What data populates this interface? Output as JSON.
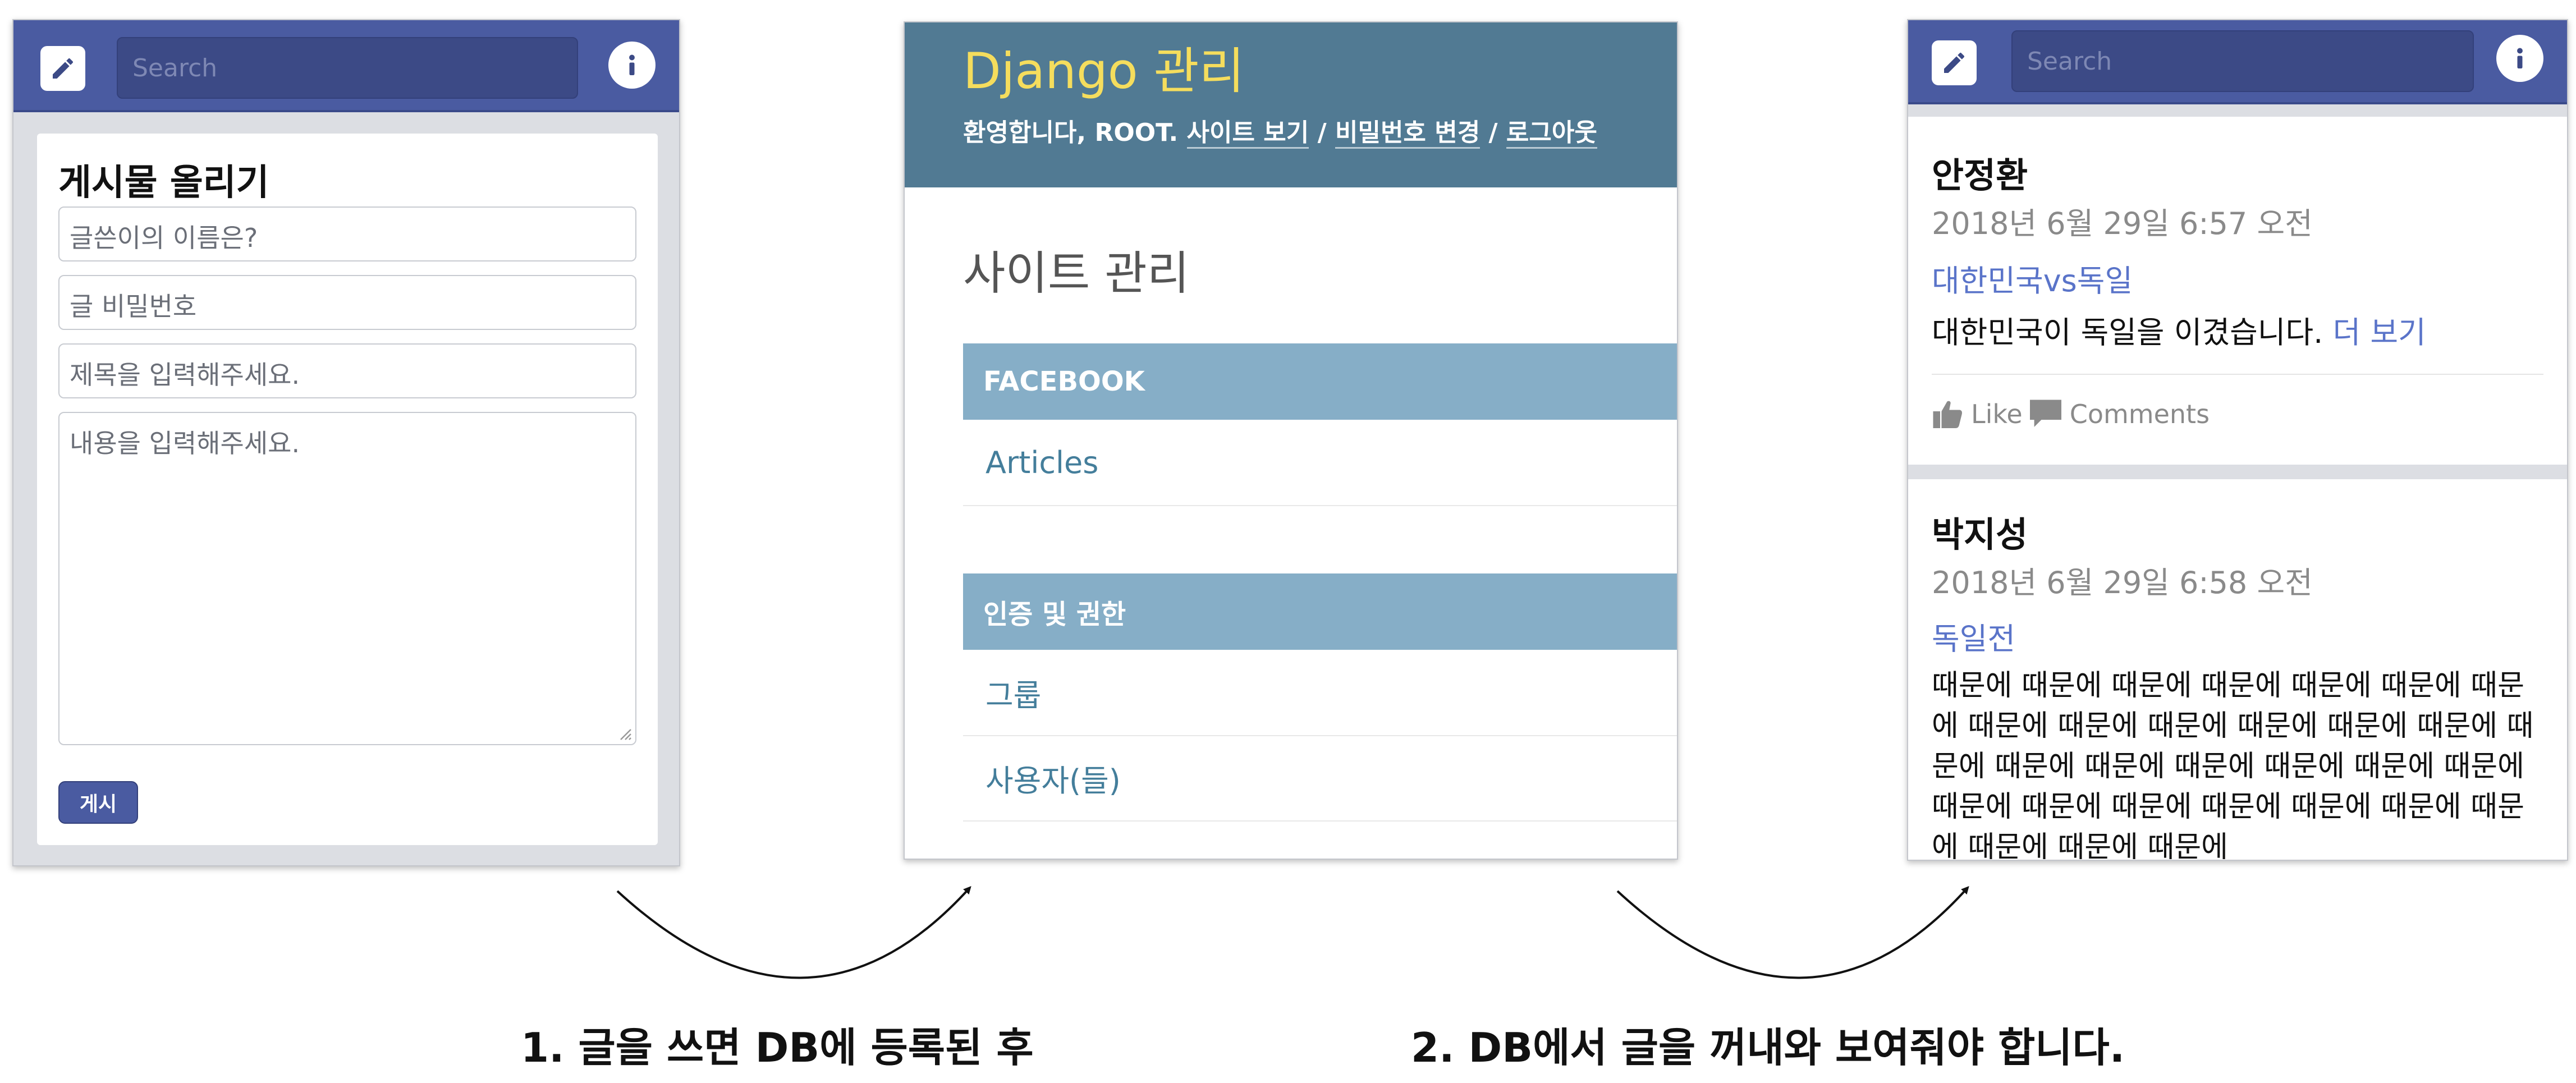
{
  "post_form": {
    "search_placeholder": "Search",
    "title": "게시물 올리기",
    "name_placeholder": "글쓴이의 이름은?",
    "password_placeholder": "글 비밀번호",
    "subject_placeholder": "제목을 입력해주세요.",
    "content_placeholder": "내용을 입력해주세요.",
    "submit_label": "게시"
  },
  "admin": {
    "brand": "Django 관리",
    "welcome": "환영합니다,",
    "user": "ROOT",
    "view_site": "사이트 보기",
    "change_password": "비밀번호 변경",
    "logout": "로그아웃",
    "site_admin_title": "사이트 관리",
    "sections": [
      {
        "caption": "FACEBOOK",
        "rows": [
          "Articles"
        ]
      },
      {
        "caption": "인증 및 권한",
        "rows": [
          "그룹",
          "사용자(들)"
        ]
      }
    ]
  },
  "feed": {
    "search_placeholder": "Search",
    "posts": [
      {
        "author": "안정환",
        "date": "2018년 6월 29일 6:57 오전",
        "title": "대한민국vs독일",
        "body": "대한민국이 독일을 이겼습니다.",
        "more": "더 보기",
        "like_label": "Like",
        "comments_label": "Comments"
      },
      {
        "author": "박지성",
        "date": "2018년 6월 29일 6:58 오전",
        "title": "독일전",
        "body": "때문에 때문에 때문에 때문에 때문에 때문에 때문에 때문에 때문에 때문에 때문에 때문에 때문에 때문에 때문에 때문에 때문에 때문에 때문에 때문에 때문에 때문에 때문에 때문에 때문에 때문에 때문에 때문에 때문에 때문에"
      }
    ]
  },
  "captions": {
    "step1": "1. 글을 쓰면 DB에 등록된 후",
    "step2": "2. DB에서 글을 꺼내와 보여줘야 합니다."
  },
  "colors": {
    "fb_blue": "#4a5ba1",
    "django_header": "#517a93",
    "django_caption": "#86aec7",
    "django_brand": "#f5dd5d",
    "link_blue": "#5a74c9"
  }
}
